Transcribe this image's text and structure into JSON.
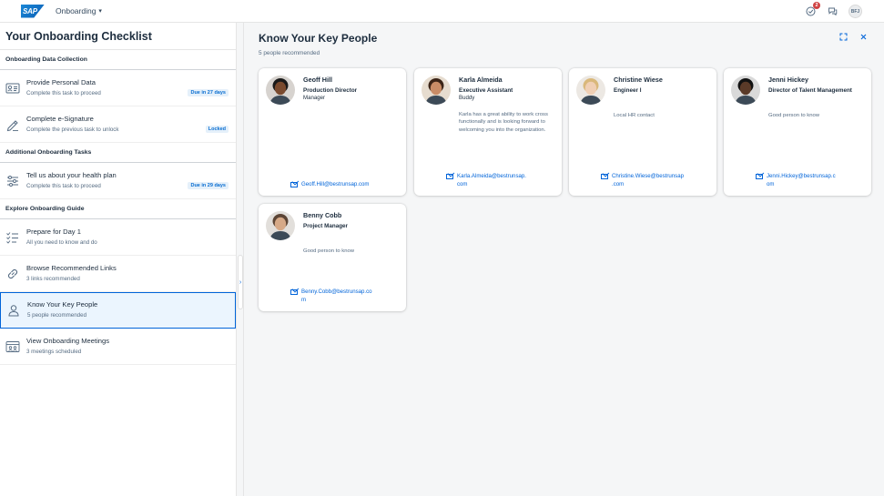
{
  "shell": {
    "logo_text": "SAP",
    "app_title": "Onboarding",
    "notification_count": "2",
    "avatar_initials": "BFJ"
  },
  "left": {
    "title": "Your Onboarding Checklist",
    "groups": [
      {
        "header": "Onboarding Data Collection",
        "items": [
          {
            "title": "Provide Personal Data",
            "sub": "Complete this task to proceed",
            "status": "Due in 27 days",
            "icon": "id-card-icon"
          },
          {
            "title": "Complete e-Signature",
            "sub": "Complete the previous task to unlock",
            "status": "Locked",
            "icon": "signature-icon"
          }
        ]
      },
      {
        "header": "Additional Onboarding Tasks",
        "items": [
          {
            "title": "Tell us about your health plan",
            "sub": "Complete this task to proceed",
            "status": "Due in 29 days",
            "icon": "sliders-icon"
          }
        ]
      },
      {
        "header": "Explore Onboarding Guide",
        "items": [
          {
            "title": "Prepare for Day 1",
            "sub": "All you need to know and do",
            "icon": "checklist-icon"
          },
          {
            "title": "Browse Recommended Links",
            "sub": "3 links recommended",
            "icon": "link-icon"
          },
          {
            "title": "Know Your Key People",
            "sub": "5 people recommended",
            "icon": "person-icon",
            "selected": true
          },
          {
            "title": "View Onboarding Meetings",
            "sub": "3 meetings scheduled",
            "icon": "meeting-icon"
          }
        ]
      }
    ]
  },
  "right": {
    "title": "Know Your Key People",
    "subtitle": "5 people recommended",
    "people": [
      {
        "name": "Geoff Hill",
        "role": "Production Director",
        "role2": "Manager",
        "desc": "",
        "email_l1": "Geoff.Hill@bestrunsap.com",
        "email_l2": "",
        "skin": "#7a4a2e",
        "hair": "#1a1a1a",
        "bg": "#d7d3cf"
      },
      {
        "name": "Karla Almeida",
        "role": "Executive Assistant",
        "role2": "Buddy",
        "desc": "Karla has a great ability to work cross functionally and is looking forward to welcoming you into the organization.",
        "email_l1": "Karla.Almeida@bestrunsap.",
        "email_l2": "com",
        "skin": "#c98c66",
        "hair": "#3b2417",
        "bg": "#e6dccf"
      },
      {
        "name": "Christine Wiese",
        "role": "Engineer I",
        "role2": "",
        "desc": "Local HR contact",
        "email_l1": "Christine.Wiese@bestrunsap",
        "email_l2": ".com",
        "skin": "#f0cfb4",
        "hair": "#d9b87a",
        "bg": "#ece8e3"
      },
      {
        "name": "Jenni Hickey",
        "role": "Director of Talent Management",
        "role2": "",
        "desc": "Good person to know",
        "email_l1": "Jenni.Hickey@bestrunsap.c",
        "email_l2": "om",
        "skin": "#5a3a28",
        "hair": "#121212",
        "bg": "#d9d9d9"
      },
      {
        "name": "Benny Cobb",
        "role": "Project Manager",
        "role2": "",
        "desc": "Good person to know",
        "email_l1": "Benny.Cobb@bestrunsap.co",
        "email_l2": "m",
        "skin": "#d6a987",
        "hair": "#5c4535",
        "bg": "#e2dfdb"
      }
    ]
  }
}
